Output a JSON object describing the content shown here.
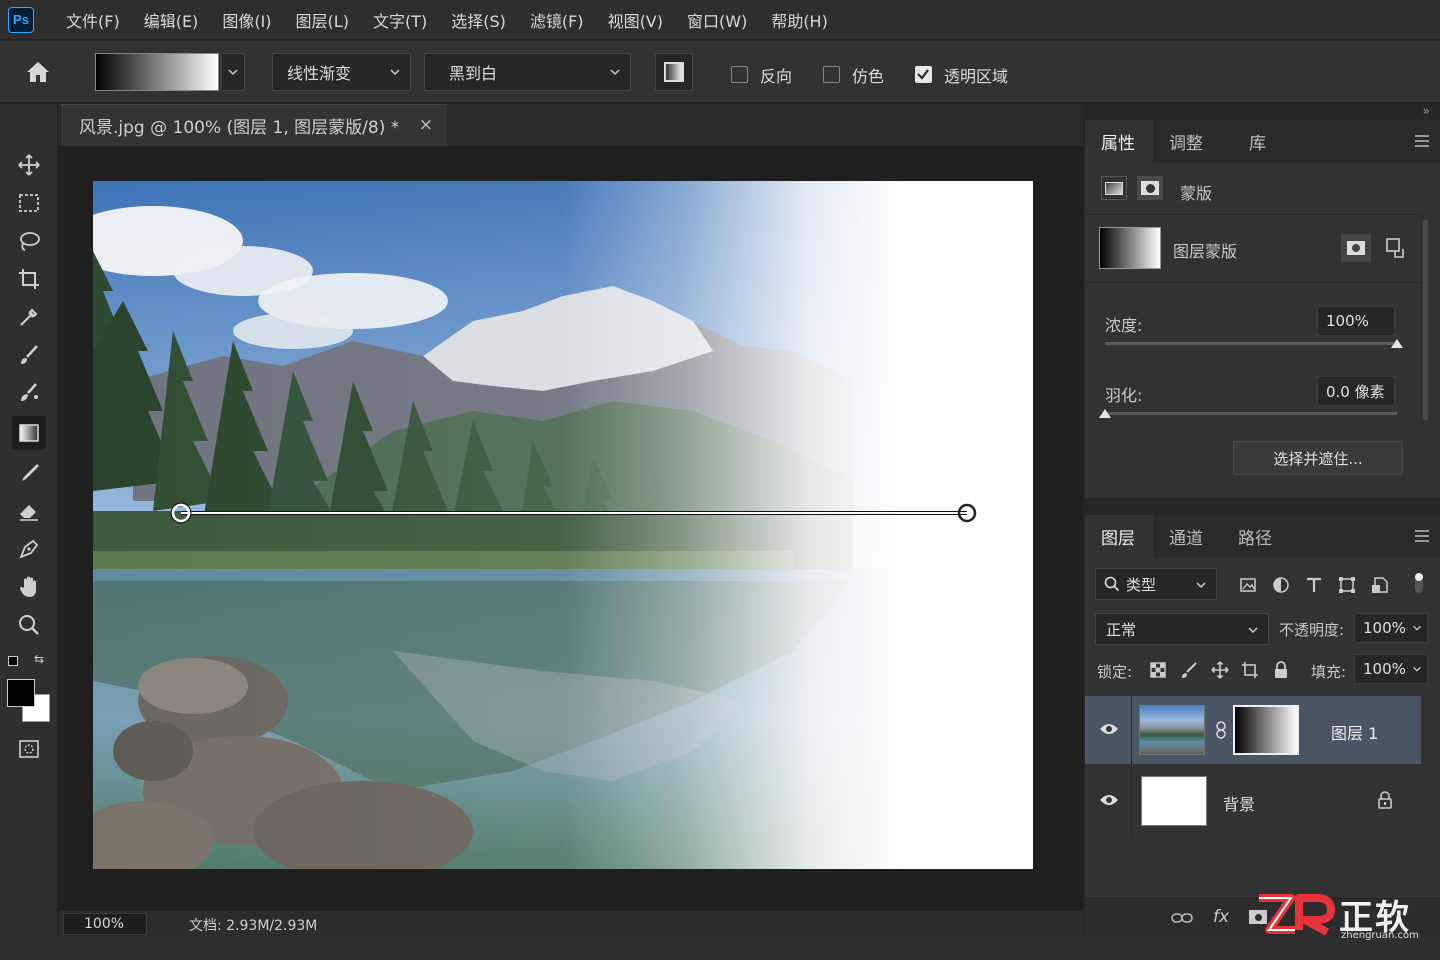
{
  "app": {
    "logo": "Ps"
  },
  "menu": [
    "文件(F)",
    "编辑(E)",
    "图像(I)",
    "图层(L)",
    "文字(T)",
    "选择(S)",
    "滤镜(F)",
    "视图(V)",
    "窗口(W)",
    "帮助(H)"
  ],
  "options": {
    "gradient_type": "线性渐变",
    "gradient_preset": "黑到白",
    "reverse_label": "反向",
    "reverse_checked": false,
    "dither_label": "仿色",
    "dither_checked": false,
    "transparency_label": "透明区域",
    "transparency_checked": true
  },
  "document": {
    "tab_title": "风景.jpg @ 100% (图层 1, 图层蒙版/8) *",
    "close": "×",
    "zoom": "100%",
    "info": "文档: 2.93M/2.93M"
  },
  "properties": {
    "tabs": [
      "属性",
      "调整",
      "库"
    ],
    "section_label": "蒙版",
    "mask_label": "图层蒙版",
    "density_label": "浓度:",
    "density_value": "100%",
    "density_level": 1.0,
    "feather_label": "羽化:",
    "feather_value": "0.0 像素",
    "feather_level": 0.0,
    "select_mask_button": "选择并遮住..."
  },
  "layers": {
    "tabs": [
      "图层",
      "通道",
      "路径"
    ],
    "filter_label": "类型",
    "blend_mode": "正常",
    "opacity_label": "不透明度:",
    "opacity_value": "100%",
    "lock_label": "锁定:",
    "fill_label": "填充:",
    "fill_value": "100%",
    "items": [
      {
        "name": "图层 1",
        "selected": true
      },
      {
        "name": "背景",
        "selected": false
      }
    ],
    "footer_fx": "fx"
  },
  "watermark": {
    "brand": "正软",
    "domain": "zhengruan.com"
  },
  "colors": {
    "accent": "#31a8ff",
    "selection": "#4a5566"
  }
}
